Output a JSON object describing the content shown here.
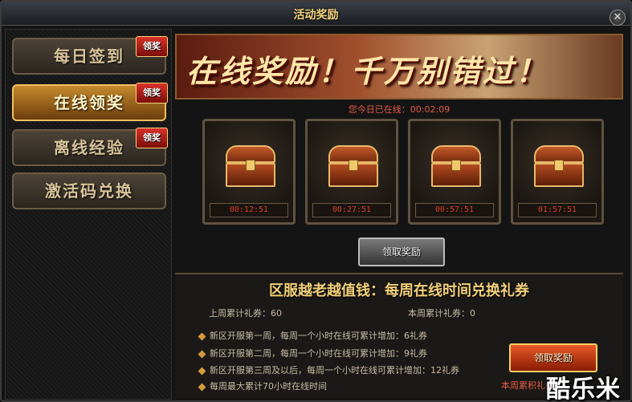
{
  "window": {
    "title": "活动奖励",
    "close_glyph": "✕"
  },
  "sidebar": {
    "items": [
      {
        "label": "每日签到",
        "badge": "领奖"
      },
      {
        "label": "在线领奖",
        "badge": "领奖"
      },
      {
        "label": "离线经验",
        "badge": "领奖"
      },
      {
        "label": "激活码兑换",
        "badge": ""
      }
    ]
  },
  "banner": {
    "text": "在线奖励！千万别错过！"
  },
  "online": {
    "text": "您今日已在线：00:02:09"
  },
  "chests": [
    {
      "time": "00:12:51"
    },
    {
      "time": "00:27:51"
    },
    {
      "time": "00:57:51"
    },
    {
      "time": "01:57:51"
    }
  ],
  "claim_button": "领取奖励",
  "exchange": {
    "title": "区服越老越值钱：每周在线时间兑换礼券",
    "last_week": "上周累计礼券：60",
    "this_week": "本周累计礼券：0",
    "rules": [
      "新区开服第一周，每周一个小时在线可累计增加：6礼券",
      "新区开服第二周，每周一个小时在线可累计增加：9礼券",
      "新区开服第三周及以后，每周一个小时在线可累计增加：12礼券",
      "每周最大累计70小时在线时间"
    ],
    "button": "领取奖励",
    "note": "本周累积礼券"
  },
  "watermark": "酷乐米"
}
